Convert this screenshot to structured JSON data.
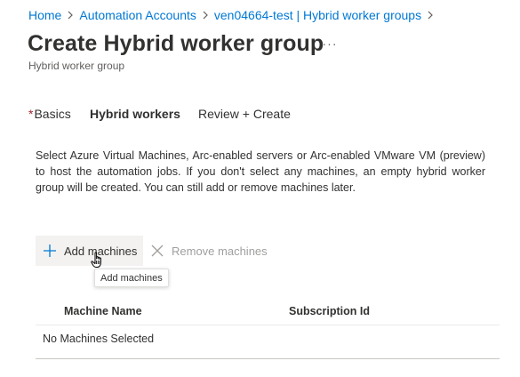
{
  "breadcrumb": {
    "items": [
      {
        "label": "Home"
      },
      {
        "label": "Automation Accounts"
      },
      {
        "label": "ven04664-test | Hybrid worker groups"
      }
    ]
  },
  "header": {
    "title": "Create Hybrid worker group",
    "subtitle": "Hybrid worker group",
    "more_label": "···"
  },
  "tabs": [
    {
      "required_marker": "*",
      "label": "Basics"
    },
    {
      "label": "Hybrid workers",
      "active": true
    },
    {
      "label": "Review + Create"
    }
  ],
  "description": "Select Azure Virtual Machines, Arc-enabled servers or Arc-enabled VMware VM (preview) to host the automation jobs. If you don't select any machines, an empty hybrid worker group will be created. You can still add or remove machines later.",
  "toolbar": {
    "add_label": "Add machines",
    "remove_label": "Remove machines"
  },
  "tooltip": {
    "text": "Add machines"
  },
  "grid": {
    "columns": [
      "Machine Name",
      "Subscription Id"
    ],
    "empty_text": "No Machines Selected"
  },
  "colors": {
    "link": "#0078d4",
    "text": "#323130",
    "secondary_text": "#605e5c",
    "disabled_text": "#a19f9d",
    "required": "#a4262c",
    "button_bg": "#f3f2f1"
  },
  "icons": {
    "add": "plus-icon",
    "remove": "close-icon",
    "breadcrumb_separator": "chevron-right-icon",
    "cursor": "hand-pointer-cursor"
  }
}
